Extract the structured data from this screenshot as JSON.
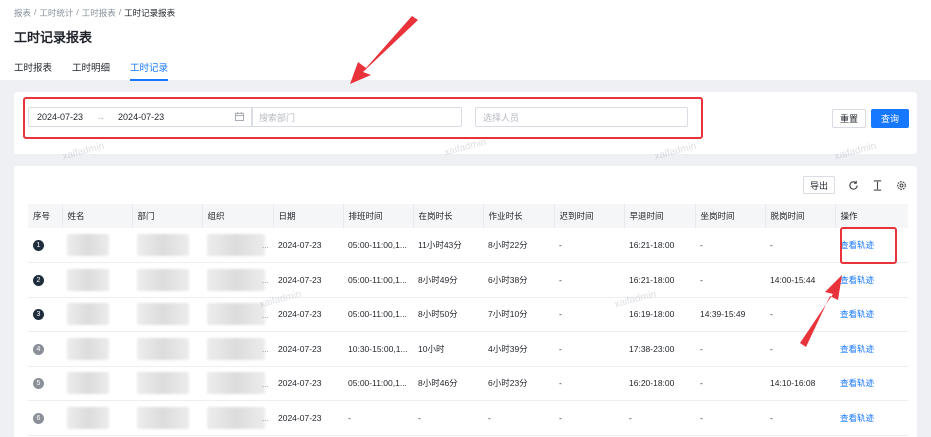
{
  "breadcrumb": [
    "报表",
    "工时统计",
    "工时报表",
    "工时记录报表"
  ],
  "page_title": "工时记录报表",
  "tabs": [
    {
      "label": "工时报表",
      "active": false
    },
    {
      "label": "工时明细",
      "active": false
    },
    {
      "label": "工时记录",
      "active": true
    }
  ],
  "filters": {
    "date_start": "2024-07-23",
    "date_sep": "→",
    "date_end": "2024-07-23",
    "dept_placeholder": "搜索部门",
    "person_placeholder": "选择人员",
    "reset_label": "重置",
    "search_label": "查询"
  },
  "toolbar": {
    "export_label": "导出",
    "icons": [
      "refresh-icon",
      "column-height-icon",
      "settings-icon"
    ]
  },
  "watermark": "xaifadmin",
  "table": {
    "columns": [
      "序号",
      "姓名",
      "部门",
      "组织",
      "日期",
      "排班时间",
      "在岗时长",
      "作业时长",
      "迟到时间",
      "早退时间",
      "坐岗时间",
      "脱岗时间",
      "操作"
    ],
    "rows": [
      {
        "index": "1",
        "date": "2024-07-23",
        "schedule": "05:00-11:00,1...",
        "on_duty": "11小时43分",
        "work": "8小时22分",
        "late": "-",
        "early": "16:21-18:00",
        "sit": "-",
        "off": "-",
        "action": "查看轨迹"
      },
      {
        "index": "2",
        "date": "2024-07-23",
        "schedule": "05:00-11:00,1...",
        "on_duty": "8小时49分",
        "work": "6小时38分",
        "late": "-",
        "early": "16:21-18:00",
        "sit": "-",
        "off": "14:00-15:44",
        "action": "查看轨迹"
      },
      {
        "index": "3",
        "date": "2024-07-23",
        "schedule": "05:00-11:00,1...",
        "on_duty": "8小时50分",
        "work": "7小时10分",
        "late": "-",
        "early": "16:19-18:00",
        "sit": "14:39-15:49",
        "off": "-",
        "action": "查看轨迹"
      },
      {
        "index": "4",
        "date": "2024-07-23",
        "schedule": "10:30-15:00,1...",
        "on_duty": "10小时",
        "work": "4小时39分",
        "late": "-",
        "early": "17:38-23:00",
        "sit": "-",
        "off": "-",
        "action": "查看轨迹"
      },
      {
        "index": "5",
        "date": "2024-07-23",
        "schedule": "05:00-11:00,1...",
        "on_duty": "8小时46分",
        "work": "6小时23分",
        "late": "-",
        "early": "16:20-18:00",
        "sit": "-",
        "off": "14:10-16:08",
        "action": "查看轨迹"
      },
      {
        "index": "6",
        "date": "2024-07-23",
        "schedule": "-",
        "on_duty": "-",
        "work": "-",
        "late": "-",
        "early": "-",
        "sit": "-",
        "off": "-",
        "action": "查看轨迹"
      }
    ]
  },
  "colors": {
    "primary": "#1677ff",
    "annotation": "#e8333b"
  }
}
